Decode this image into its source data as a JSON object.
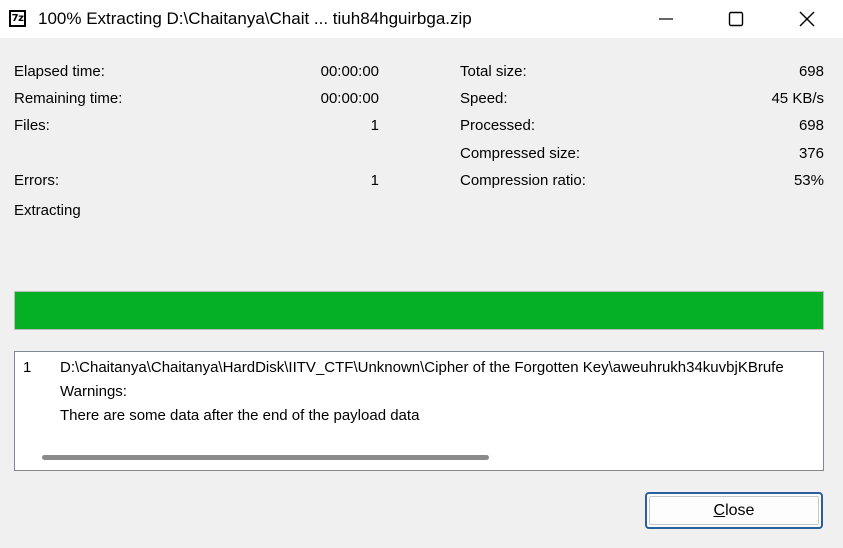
{
  "window": {
    "icon_text": "7z",
    "title": "100% Extracting D:\\Chaitanya\\Chait ... tiuh84hguirbga.zip"
  },
  "stats_left": [
    {
      "label": "Elapsed time:",
      "value": "00:00:00"
    },
    {
      "label": "Remaining time:",
      "value": "00:00:00"
    },
    {
      "label": "Files:",
      "value": "1"
    },
    {
      "label": "Errors:",
      "value": "1"
    }
  ],
  "stats_right": [
    {
      "label": "Total size:",
      "value": "698"
    },
    {
      "label": "Speed:",
      "value": "45 KB/s"
    },
    {
      "label": "Processed:",
      "value": "698"
    },
    {
      "label": "Compressed size:",
      "value": "376"
    },
    {
      "label": "Compression ratio:",
      "value": "53%"
    }
  ],
  "status_text": "Extracting",
  "progress": {
    "percent": 100,
    "color": "#06b025"
  },
  "log": {
    "rows": [
      {
        "index": "1",
        "path": "D:\\Chaitanya\\Chaitanya\\HardDisk\\IITV_CTF\\Unknown\\Cipher of the Forgotten Key\\aweuhrukh34kuvbjKBrufe",
        "warning_heading": "Warnings:",
        "warning_text": "There are some data after the end of the payload data"
      }
    ]
  },
  "buttons": {
    "close_label": "Close"
  },
  "icons": {
    "minimize": "minimize-icon",
    "maximize": "maximize-icon",
    "close": "close-icon",
    "app": "7zip-app-icon"
  },
  "colors": {
    "progress_fill": "#06b025",
    "button_border": "#2a5f9e",
    "background": "#f0f0f0"
  }
}
